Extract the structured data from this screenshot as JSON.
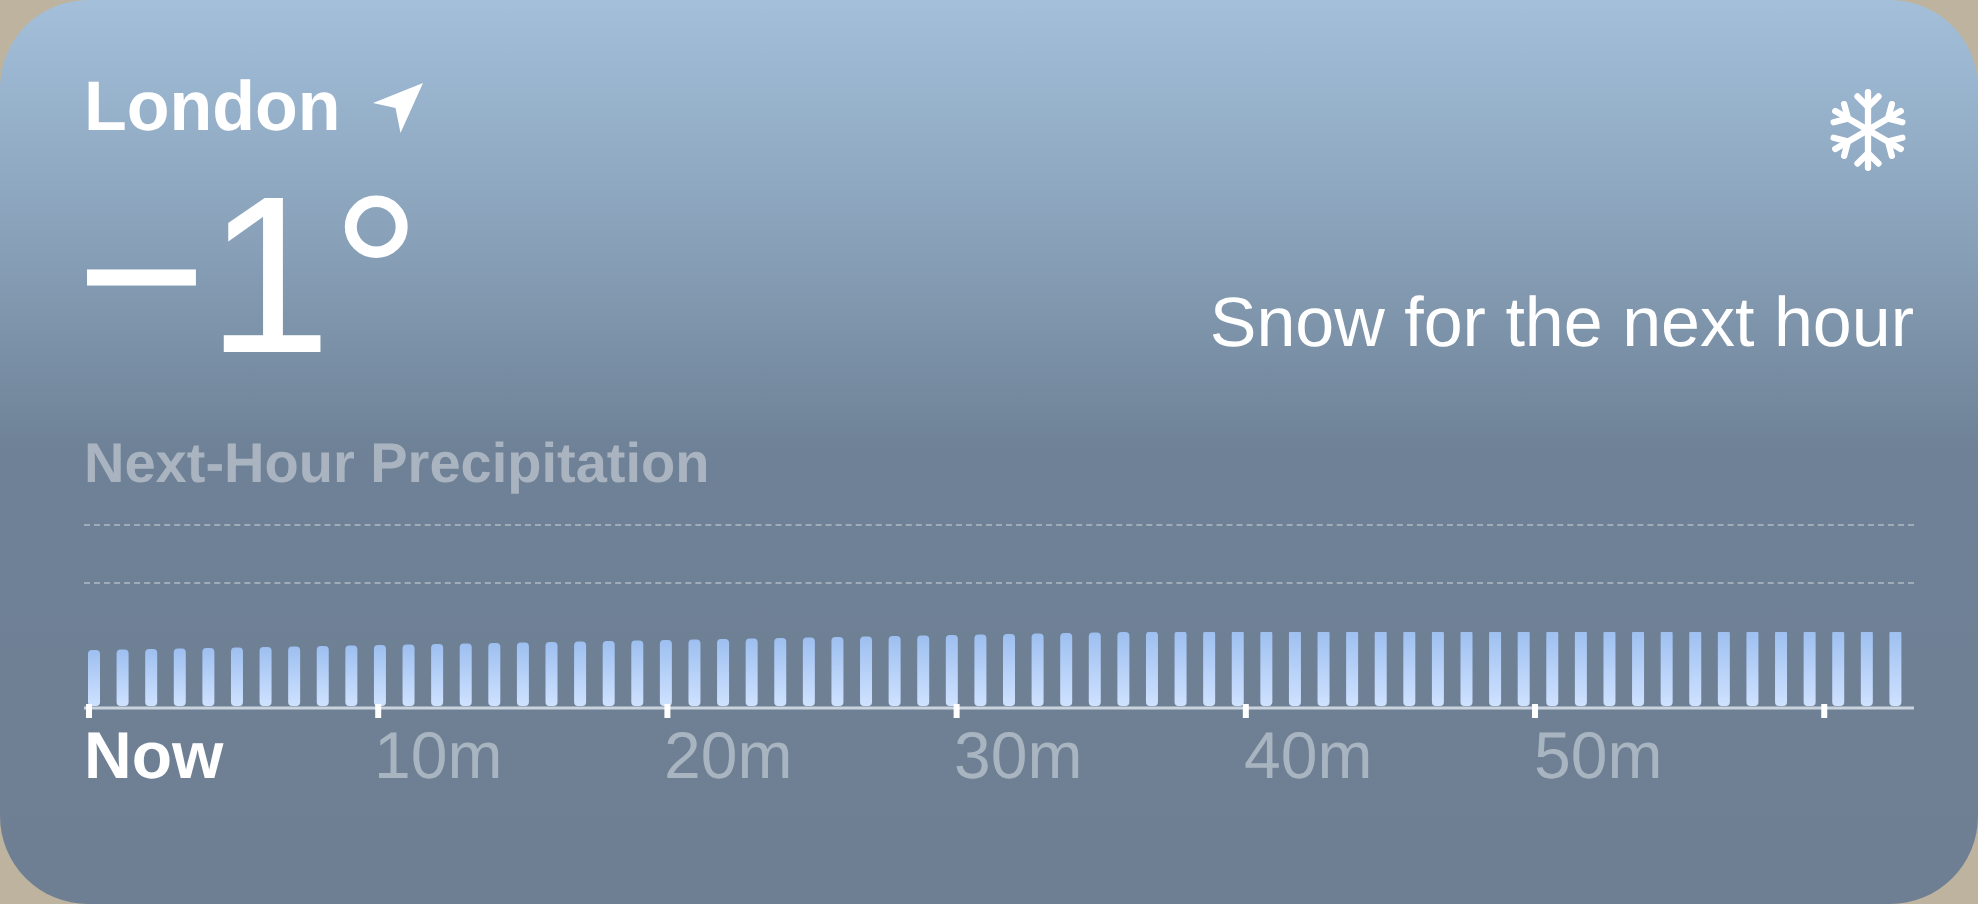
{
  "location": {
    "name": "London",
    "current_location": true
  },
  "temperature": "−1°",
  "summary": "Snow for the next hour",
  "precipitation": {
    "title": "Next-Hour Precipitation",
    "axis_labels": [
      {
        "label": "Now",
        "selected": true
      },
      {
        "label": "10m",
        "selected": false
      },
      {
        "label": "20m",
        "selected": false
      },
      {
        "label": "30m",
        "selected": false
      },
      {
        "label": "40m",
        "selected": false
      },
      {
        "label": "50m",
        "selected": false
      }
    ]
  }
}
